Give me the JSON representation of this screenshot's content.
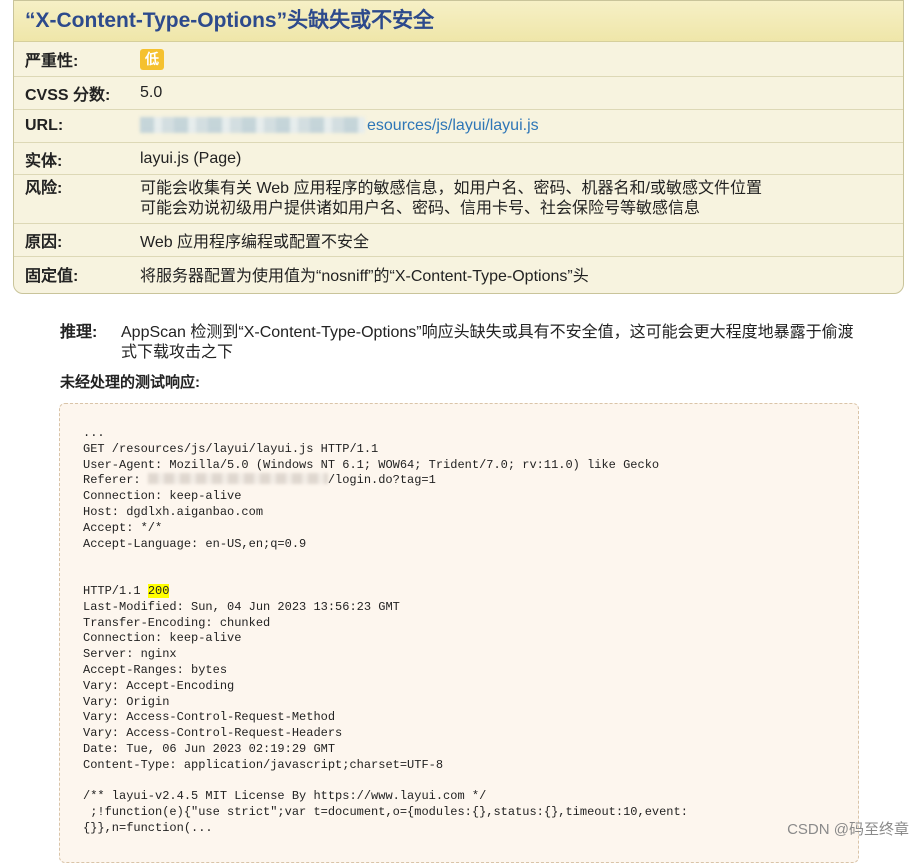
{
  "card": {
    "title": "“X-Content-Type-Options”头缺失或不安全",
    "severity": {
      "label": "严重性:",
      "value": "低",
      "color": "#f5c12f"
    },
    "cvss": {
      "label": "CVSS 分数:",
      "value": "5.0"
    },
    "url": {
      "label": "URL:",
      "value": "esources/js/layui/layui.js"
    },
    "entity": {
      "label": "实体:",
      "value": "layui.js (Page)"
    },
    "risk": {
      "label": "风险:",
      "line1": "可能会收集有关 Web 应用程序的敏感信息，如用户名、密码、机器名和/或敏感文件位置",
      "line2": "可能会劝说初级用户提供诸如用户名、密码、信用卡号、社会保险号等敏感信息"
    },
    "cause": {
      "label": "原因:",
      "value": "Web 应用程序编程或配置不安全"
    },
    "fix": {
      "label": "固定值:",
      "value": "将服务器配置为使用值为“nosniff”的“X-Content-Type-Options”头"
    }
  },
  "reasoning": {
    "label": "推理:",
    "text": "AppScan 检测到“X-Content-Type-Options”响应头缺失或具有不安全值，这可能会更大程度地暴露于偷渡式下载攻击之下"
  },
  "raw_label": "未经处理的测试响应:",
  "code": {
    "ellipsis": "...",
    "request_line": "GET /resources/js/layui/layui.js HTTP/1.1",
    "user_agent": "User-Agent: Mozilla/5.0 (Windows NT 6.1; WOW64; Trident/7.0; rv:11.0) like Gecko",
    "referer_prefix": "Referer: ",
    "referer_suffix": "/login.do?tag=1",
    "connection_req": "Connection: keep-alive",
    "host": "Host: dgdlxh.aiganbao.com",
    "accept": "Accept: */*",
    "accept_language": "Accept-Language: en-US,en;q=0.9",
    "status_prefix": "HTTP/1.1 ",
    "status_code": "200",
    "resp_lines": [
      "Last-Modified: Sun, 04 Jun 2023 13:56:23 GMT",
      "Transfer-Encoding: chunked",
      "Connection: keep-alive",
      "Server: nginx",
      "Accept-Ranges: bytes",
      "Vary: Accept-Encoding",
      "Vary: Origin",
      "Vary: Access-Control-Request-Method",
      "Vary: Access-Control-Request-Headers",
      "Date: Tue, 06 Jun 2023 02:19:29 GMT",
      "Content-Type: application/javascript;charset=UTF-8"
    ],
    "body_lines": [
      "/** layui-v2.4.5 MIT License By https://www.layui.com */",
      " ;!function(e){\"use strict\";var t=document,o={modules:{},status:{},timeout:10,event:",
      "{}},n=function(..."
    ]
  },
  "watermark": "CSDN @码至终章"
}
